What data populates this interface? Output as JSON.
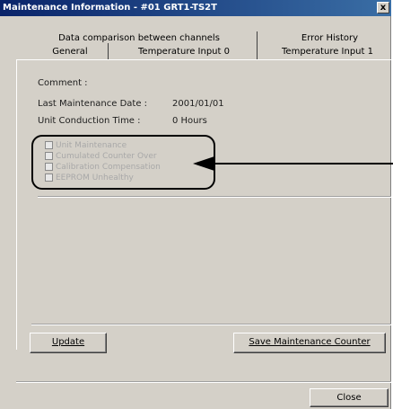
{
  "window": {
    "title": "Maintenance Information - #01 GRT1-TS2T",
    "close_glyph": "x"
  },
  "tabs_row1": [
    {
      "label": "Data comparison between channels"
    },
    {
      "label": "Error History"
    }
  ],
  "tabs_row2": [
    {
      "label": "General",
      "active": true
    },
    {
      "label": "Temperature Input 0"
    },
    {
      "label": "Temperature Input 1"
    }
  ],
  "general": {
    "comment_label": "Comment :",
    "last_maintenance_label": "Last Maintenance Date :",
    "last_maintenance_value": "2001/01/01",
    "unit_conduction_label": "Unit Conduction Time :",
    "unit_conduction_value": "0 Hours"
  },
  "checkboxes": [
    {
      "label": "Unit Maintenance",
      "checked": false,
      "enabled": false
    },
    {
      "label": "Cumulated Counter Over",
      "checked": false,
      "enabled": false
    },
    {
      "label": "Calibration Compensation",
      "checked": false,
      "enabled": false
    },
    {
      "label": "EEPROM Unhealthy",
      "checked": false,
      "enabled": false
    }
  ],
  "buttons": {
    "update": "Update",
    "save_counter": "Save Maintenance Counter",
    "close": "Close"
  },
  "colors": {
    "dialog_bg": "#d4d0c8",
    "title_bar": "#0a246a",
    "callout": "#000000"
  }
}
